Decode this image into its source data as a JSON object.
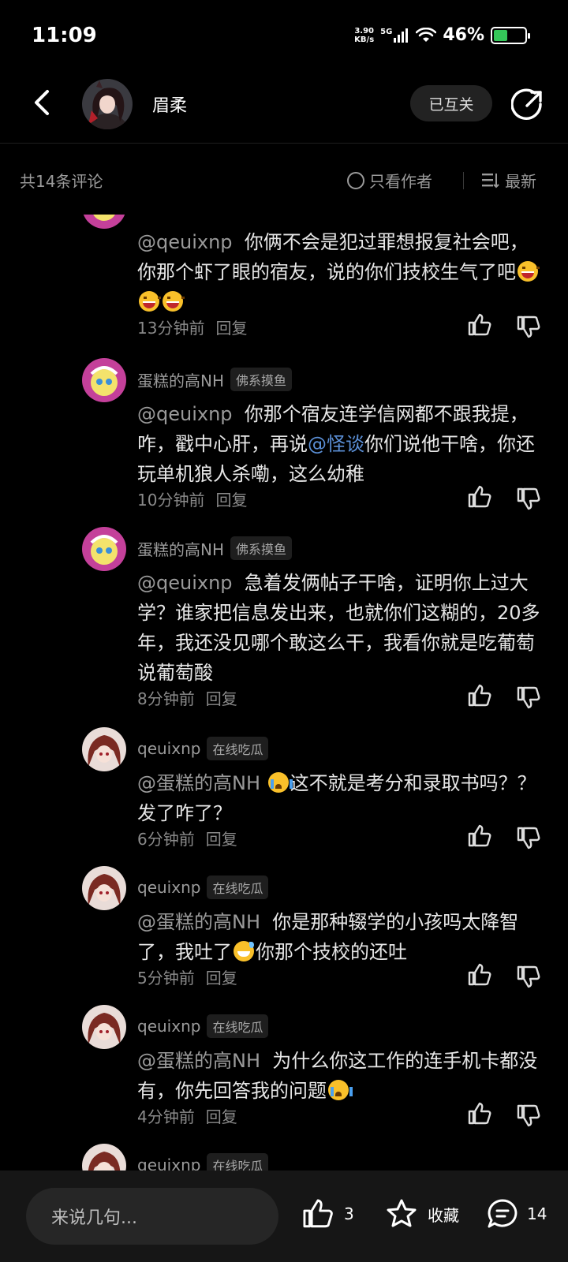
{
  "status_bar": {
    "time": "11:09",
    "net_speed_value": "3.90",
    "net_speed_unit": "KB/s",
    "network": "5G",
    "battery_percent": "46%",
    "battery_level": 0.46,
    "battery_color": "#35c759"
  },
  "header": {
    "title": "眉柔",
    "mutual_label": "已互关",
    "back_icon": "chevron-left-icon",
    "share_icon": "share-icon"
  },
  "filter": {
    "count_label": "共14条评论",
    "author_only_label": "只看作者",
    "sort_label": "最新"
  },
  "comments": [
    {
      "username": "",
      "badge": "",
      "mention": "@qeuixnp",
      "text": "你俩不会是犯过罪想报复社会吧，你那个虾了眼的宿友，说的你们技校生气了吧",
      "emoji": "grin x3",
      "time": "13分钟前",
      "reply": "回复"
    },
    {
      "username": "蛋糕的高NH",
      "badge": "佛系摸鱼",
      "mention": "@qeuixnp",
      "text_before_link": "你那个宿友连学信网都不跟我提，咋，戳中心肝，再说",
      "link": "@怪谈",
      "text_after_link": "你们说他干啥，你还玩单机狼人杀嘞，这么幼稚",
      "time": "10分钟前",
      "reply": "回复"
    },
    {
      "username": "蛋糕的高NH",
      "badge": "佛系摸鱼",
      "mention": "@qeuixnp",
      "text": "急着发俩帖子干啥，证明你上过大学？谁家把信息发出来，也就你们这糊的，20多年，我还没见哪个敢这么干，我看你就是吃葡萄说葡萄酸",
      "time": "8分钟前",
      "reply": "回复"
    },
    {
      "username": "qeuixnp",
      "badge": "在线吃瓜",
      "mention": "@蛋糕的高NH",
      "text": "这不就是考分和录取书吗？？发了咋了？",
      "emoji": "cry",
      "time": "6分钟前",
      "reply": "回复"
    },
    {
      "username": "qeuixnp",
      "badge": "在线吃瓜",
      "mention": "@蛋糕的高NH",
      "text_before_emoji": "你是那种辍学的小孩吗太降智了，我吐了",
      "text_after_emoji": "你那个技校的还吐",
      "emoji": "sweat",
      "time": "5分钟前",
      "reply": "回复"
    },
    {
      "username": "qeuixnp",
      "badge": "在线吃瓜",
      "mention": "@蛋糕的高NH",
      "text": "为什么你这工作的连手机卡都没有，你先回答我的问题",
      "emoji": "cry",
      "time": "4分钟前",
      "reply": "回复"
    },
    {
      "username": "qeuixnp",
      "badge": "在线吃瓜"
    }
  ],
  "bottom_bar": {
    "input_placeholder": "来说几句...",
    "like_count": "3",
    "favorite_label": "收藏",
    "comment_count": "14"
  }
}
